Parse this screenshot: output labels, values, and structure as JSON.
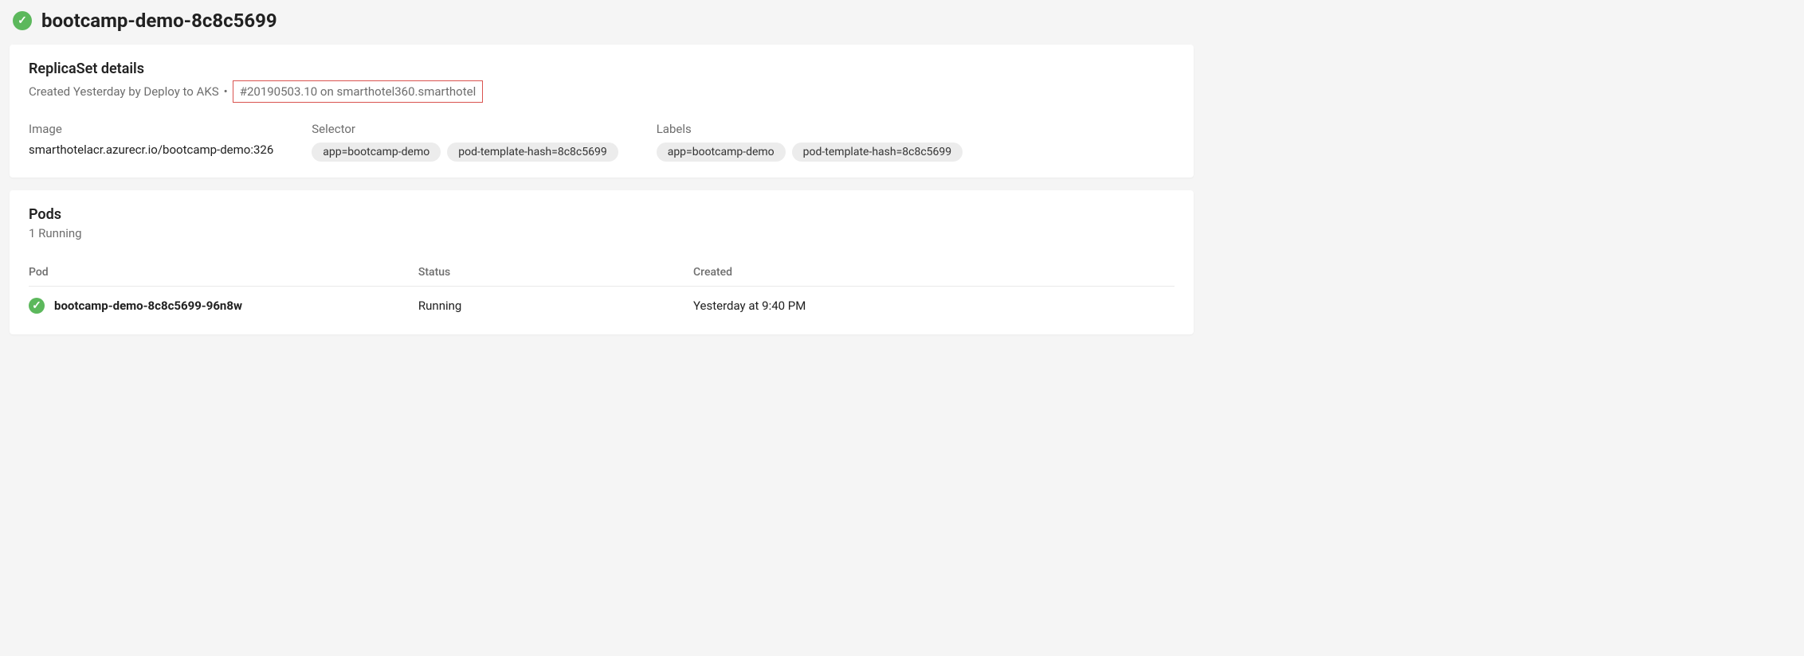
{
  "header": {
    "title": "bootcamp-demo-8c8c5699",
    "status": "success"
  },
  "details": {
    "title": "ReplicaSet details",
    "created_prefix": "Created Yesterday by Deploy to AKS",
    "separator": "•",
    "build_link": "#20190503.10 on smarthotel360.smarthotel",
    "image": {
      "label": "Image",
      "value": "smarthotelacr.azurecr.io/bootcamp-demo:326"
    },
    "selector": {
      "label": "Selector",
      "pills": [
        "app=bootcamp-demo",
        "pod-template-hash=8c8c5699"
      ]
    },
    "labels": {
      "label": "Labels",
      "pills": [
        "app=bootcamp-demo",
        "pod-template-hash=8c8c5699"
      ]
    }
  },
  "pods": {
    "title": "Pods",
    "subtitle": "1 Running",
    "columns": {
      "pod": "Pod",
      "status": "Status",
      "created": "Created"
    },
    "rows": [
      {
        "name": "bootcamp-demo-8c8c5699-96n8w",
        "status": "Running",
        "created": "Yesterday at 9:40 PM"
      }
    ]
  }
}
